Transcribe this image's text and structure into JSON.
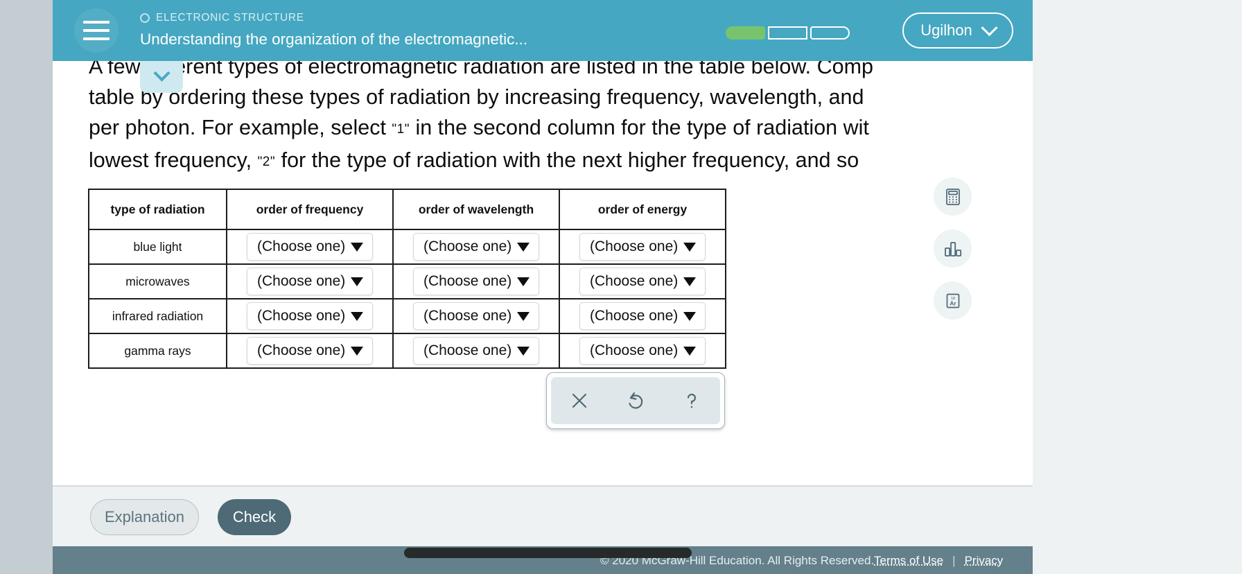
{
  "header": {
    "menu_icon": "hamburger-icon",
    "eyebrow_icon": "circle-outline-icon",
    "eyebrow": "ELECTRONIC STRUCTURE",
    "title": "Understanding the organization of the electromagnetic...",
    "progress": {
      "total_segments": 3,
      "filled_segments": 1,
      "fill_color": "#78c46e"
    },
    "user": {
      "name": "Ugilhon",
      "chevron_icon": "chevron-down-icon"
    },
    "background_color": "#45a7c1"
  },
  "collapse_tab": {
    "icon": "chevron-down-icon"
  },
  "statement": {
    "line1": "A few different types of electromagnetic radiation are listed in the table below. Comp",
    "line2": "table by ordering these types of radiation by increasing frequency, wavelength, and",
    "line3_a": "per photon. For example, select ",
    "line3_q1": "\"1\"",
    "line3_b": " in the second column for the type of radiation wit",
    "line4_a": "lowest frequency, ",
    "line4_q2": "\"2\"",
    "line4_b": " for the type of radiation with the next higher frequency, and so"
  },
  "table": {
    "headers": [
      "type of radiation",
      "order of frequency",
      "order of wavelength",
      "order of energy"
    ],
    "select_placeholder": "(Choose one)",
    "rows": [
      {
        "radiation": "blue light",
        "frequency": "(Choose one)",
        "wavelength": "(Choose one)",
        "energy": "(Choose one)"
      },
      {
        "radiation": "microwaves",
        "frequency": "(Choose one)",
        "wavelength": "(Choose one)",
        "energy": "(Choose one)"
      },
      {
        "radiation": "infrared radiation",
        "frequency": "(Choose one)",
        "wavelength": "(Choose one)",
        "energy": "(Choose one)"
      },
      {
        "radiation": "gamma rays",
        "frequency": "(Choose one)",
        "wavelength": "(Choose one)",
        "energy": "(Choose one)"
      }
    ]
  },
  "mini_toolbar": {
    "buttons": [
      {
        "name": "clear-button",
        "icon": "close-x-icon"
      },
      {
        "name": "undo-button",
        "icon": "undo-arrow-icon"
      },
      {
        "name": "help-button",
        "icon": "question-mark-icon"
      }
    ]
  },
  "tool_rail": {
    "buttons": [
      {
        "name": "calculator-tool",
        "icon": "calculator-icon"
      },
      {
        "name": "chart-tool",
        "icon": "bar-chart-icon"
      },
      {
        "name": "periodic-table-tool",
        "icon": "periodic-element-icon",
        "element_number": "18",
        "element_symbol": "Ar"
      }
    ]
  },
  "actions": {
    "explanation_label": "Explanation",
    "check_label": "Check",
    "check_color": "#4d6a76"
  },
  "footer": {
    "copyright": "© 2020 McGraw-Hill Education. All Rights Reserved.",
    "terms_label": "Terms of Use",
    "divider": "|",
    "privacy_label": "Privacy",
    "background_color": "#63808b"
  }
}
